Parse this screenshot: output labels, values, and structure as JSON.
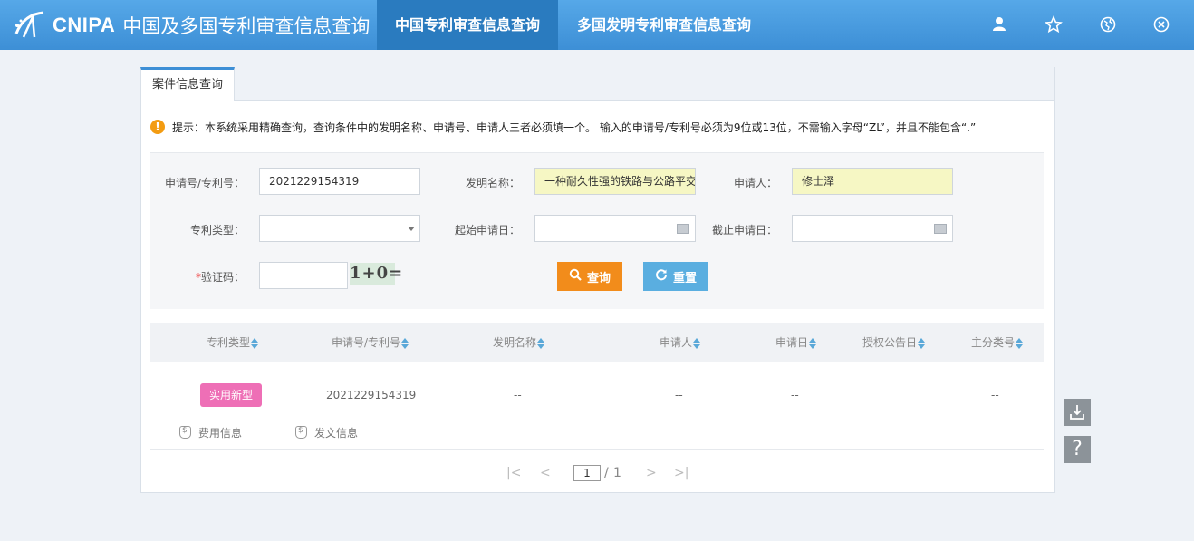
{
  "header": {
    "brand": "CNIPA",
    "title": "中国及多国专利审查信息查询",
    "tabs": [
      "中国专利审查信息查询",
      "多国发明专利审查信息查询"
    ],
    "icons": [
      "user-icon",
      "star-icon",
      "globe-icon",
      "close-icon"
    ]
  },
  "panel": {
    "tab_label": "案件信息查询",
    "tip": "提示：本系统采用精确查询，查询条件中的发明名称、申请号、申请人三者必须填一个。 输入的申请号/专利号必须为9位或13位，不需输入字母“ZL”，并且不能包含“.”"
  },
  "form": {
    "app_no_label": "申请号/专利号：",
    "app_no_value": "2021229154319",
    "invention_label": "发明名称：",
    "invention_value": "一种耐久性强的铁路与公路平交",
    "applicant_label": "申请人：",
    "applicant_value": "修士泽",
    "patent_type_label": "专利类型：",
    "patent_type_value": "",
    "start_date_label": "起始申请日：",
    "end_date_label": "截止申请日：",
    "captcha_label_req": "*",
    "captcha_label": "验证码：",
    "captcha_value": "",
    "captcha_image_text": "1+0=",
    "query_button": "查询",
    "reset_button": "重置"
  },
  "table": {
    "columns": [
      "专利类型",
      "申请号/专利号",
      "发明名称",
      "申请人",
      "申请日",
      "授权公告日",
      "主分类号"
    ],
    "rows": [
      {
        "type": "实用新型",
        "app_no": "2021229154319",
        "invention": "--",
        "applicant": "--",
        "date": "--",
        "grant_date": "",
        "class": "--"
      }
    ],
    "fee_info": "费用信息",
    "doc_info": "发文信息"
  },
  "pager": {
    "first": "|<",
    "prev": "<",
    "current": "1",
    "sep": "/",
    "total": "1",
    "next": ">",
    "last": ">|"
  },
  "side_buttons": {
    "download_icon": "download-icon",
    "help": "?"
  },
  "colors": {
    "header_blue": "#3d8fd6",
    "active_tab": "#2a7bbf",
    "query_orange": "#f28c1b",
    "reset_blue": "#5aaee0",
    "badge_pink": "#ee6fb6",
    "highlight_yellow": "#f6f7c4"
  }
}
